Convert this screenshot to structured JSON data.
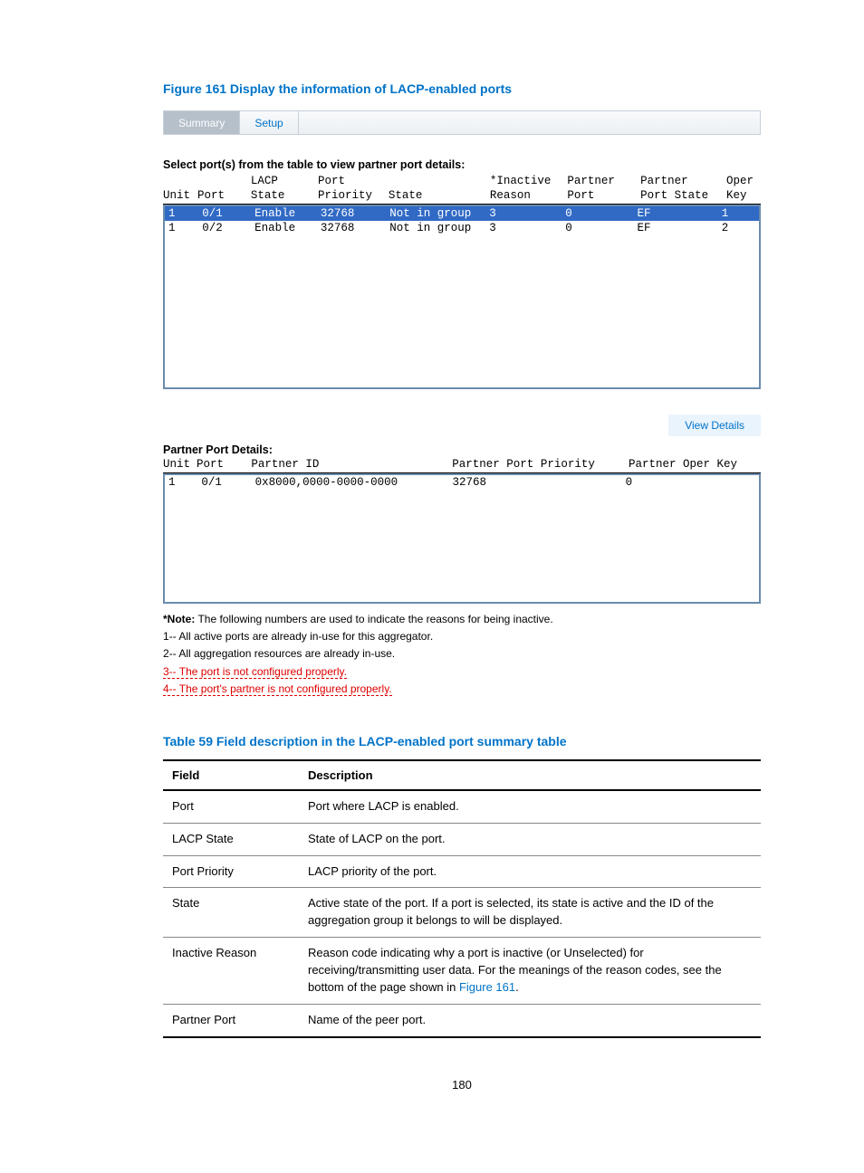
{
  "figure_title": "Figure 161 Display the information of LACP-enabled ports",
  "tabs": {
    "summary": "Summary",
    "setup": "Setup"
  },
  "instruction": "Select port(s) from the table to view partner port details:",
  "headers_top": {
    "lacp": "LACP",
    "port": "Port",
    "inactive": "*Inactive",
    "partner1": "Partner",
    "partner2": "Partner",
    "oper": "Oper"
  },
  "headers_bot": {
    "unit": "Unit",
    "port": "Port",
    "state": "State",
    "priority": "Priority",
    "state2": "State",
    "reason": "Reason",
    "pport": "Port",
    "pstate": "Port State",
    "key": "Key"
  },
  "rows": [
    {
      "unit": "1",
      "port": "0/1",
      "lacp": "Enable",
      "prio": "32768",
      "state": "Not in group",
      "reason": "3",
      "pport": "0",
      "pstate": "EF",
      "okey": "1"
    },
    {
      "unit": "1",
      "port": "0/2",
      "lacp": "Enable",
      "prio": "32768",
      "state": "Not in group",
      "reason": "3",
      "pport": "0",
      "pstate": "EF",
      "okey": "2"
    }
  ],
  "view_details": "View Details",
  "partner_label": "Partner Port Details:",
  "partner_headers": {
    "unit": "Unit",
    "port": "Port",
    "pid": "Partner ID",
    "prio": "Partner Port Priority",
    "okey": "Partner Oper Key"
  },
  "partner_rows": [
    {
      "unit": "1",
      "port": "0/1",
      "pid": "0x8000,0000-0000-0000",
      "prio": "32768",
      "okey": "0"
    }
  ],
  "notes": {
    "note_label": "*Note:",
    "note_text": " The following numbers are used to indicate the reasons for being inactive.",
    "r1": "1-- All active ports are already in-use for this aggregator.",
    "r2": "2-- All aggregation resources are already in-use.",
    "r3": "3-- The port is not configured properly.",
    "r4": "4-- The port's partner is not configured properly."
  },
  "table_title": "Table 59 Field description in the LACP-enabled port summary table",
  "th_field": "Field",
  "th_desc": "Description",
  "field_rows": [
    {
      "field": "Port",
      "desc": "Port where LACP is enabled."
    },
    {
      "field": "LACP State",
      "desc": "State of LACP on the port."
    },
    {
      "field": "Port Priority",
      "desc": "LACP priority of the port."
    },
    {
      "field": "State",
      "desc": "Active state of the port. If a port is selected, its state is active and the ID of the aggregation group it belongs to will be displayed."
    },
    {
      "field": "Inactive Reason",
      "desc_pre": "Reason code indicating why a port is inactive (or Unselected) for receiving/transmitting user data. For the meanings of the reason codes, see the bottom of the page shown in ",
      "link": "Figure 161",
      "desc_post": "."
    },
    {
      "field": "Partner Port",
      "desc": "Name of the peer port."
    }
  ],
  "page_number": "180"
}
